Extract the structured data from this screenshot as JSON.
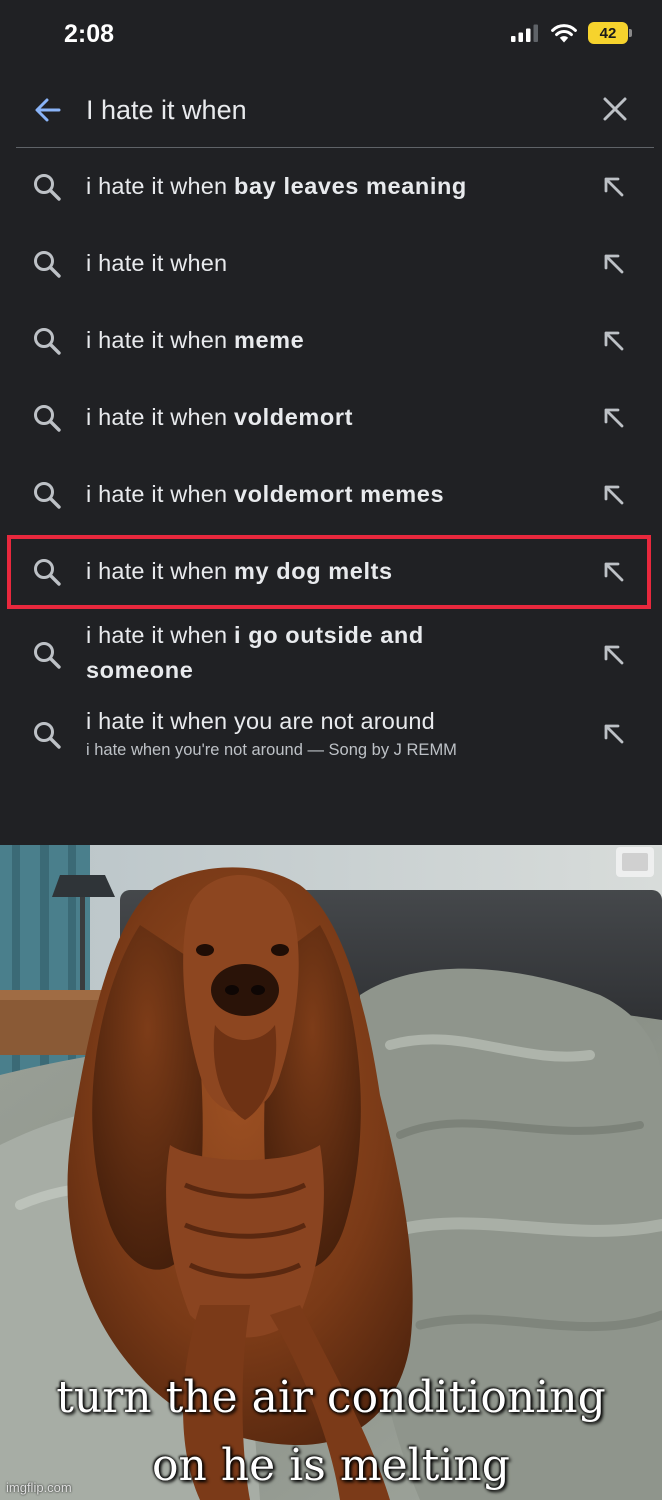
{
  "status_bar": {
    "time": "2:08",
    "battery_level": "42",
    "icons": [
      "cellular-signal-icon",
      "wifi-icon",
      "battery-icon"
    ]
  },
  "search": {
    "query": "I hate it when",
    "back_icon": "arrow-left-icon",
    "clear_icon": "close-icon"
  },
  "suggestions": [
    {
      "prefix": "i hate it when ",
      "bold": "bay leaves meaning",
      "sub": ""
    },
    {
      "prefix": "i hate it when",
      "bold": "",
      "sub": ""
    },
    {
      "prefix": "i hate it when ",
      "bold": "meme",
      "sub": ""
    },
    {
      "prefix": "i hate it when ",
      "bold": "voldemort",
      "sub": ""
    },
    {
      "prefix": "i hate it when ",
      "bold": "voldemort memes",
      "sub": ""
    },
    {
      "prefix": "i hate it when ",
      "bold": "my dog melts",
      "sub": ""
    },
    {
      "prefix": "i hate it when ",
      "bold": "i go outside and someone",
      "sub": ""
    },
    {
      "prefix": "i hate it when you are not around",
      "bold": "",
      "sub": "i hate when you're not around — Song by J REMM"
    }
  ],
  "highlighted_suggestion_index": 5,
  "colors": {
    "background": "#202124",
    "text": "#e8eaed",
    "accent_blue": "#8ab4f8",
    "highlight_red": "#e8283d",
    "battery_yellow": "#f6d32d"
  },
  "meme": {
    "caption_line1": "turn the air conditioning",
    "caption_line2": "on he is melting",
    "watermark": "imgflip.com"
  }
}
